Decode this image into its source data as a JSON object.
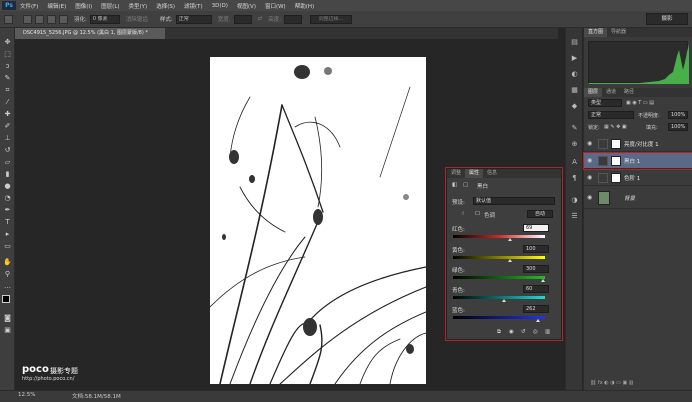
{
  "app": {
    "logo": "Ps"
  },
  "menu": [
    "文件(F)",
    "编辑(E)",
    "图像(I)",
    "图层(L)",
    "类型(Y)",
    "选择(S)",
    "滤镜(T)",
    "3D(D)",
    "视图(V)",
    "窗口(W)",
    "帮助(H)"
  ],
  "options_bar": {
    "feather_label": "羽化:",
    "feather_value": "0 像素",
    "antialias_label": "消除锯齿",
    "style_label": "样式:",
    "style_value": "正常",
    "width_label": "宽度:",
    "height_label": "高度:",
    "refine_button": "调整边缘...",
    "workspace": "摄影"
  },
  "document": {
    "tab_title": "DSC4915_5256.JPG @ 12.5% (黑白 1, 图层蒙版/8) *"
  },
  "properties": {
    "tabs": [
      "调整",
      "属性",
      "信息"
    ],
    "title": "黑白",
    "preset_label": "预设:",
    "preset_value": "默认值",
    "tint_label": "色调",
    "auto_button": "自动",
    "sliders": [
      {
        "label": "红色:",
        "value": "69",
        "percent": 0.62,
        "from": "#c82a2a",
        "to": "#ffffff",
        "start": "#000000"
      },
      {
        "label": "黄色:",
        "value": "100",
        "percent": 0.62,
        "from": "#000000",
        "to": "#ffff00"
      },
      {
        "label": "绿色:",
        "value": "300",
        "percent": 0.98,
        "from": "#000000",
        "to": "#21c021"
      },
      {
        "label": "青色:",
        "value": "60",
        "percent": 0.55,
        "from": "#000000",
        "to": "#22d8d8"
      },
      {
        "label": "蓝色:",
        "value": "262",
        "percent": 0.92,
        "from": "#000000",
        "to": "#2233ee"
      }
    ]
  },
  "panels": {
    "histogram_tabs": [
      "直方图",
      "导航器"
    ],
    "layers_tabs": [
      "图层",
      "通道",
      "路径"
    ],
    "kind_value": "类型",
    "blend_value": "正常",
    "opacity_label": "不透明度:",
    "opacity_value": "100%",
    "lock_label": "锁定:",
    "fill_label": "填充:",
    "fill_value": "100%",
    "layers": [
      {
        "name": "亮度/对比度 1",
        "selected": false
      },
      {
        "name": "黑白 1",
        "selected": true
      },
      {
        "name": "色阶 1",
        "selected": false
      },
      {
        "name": "背景",
        "selected": false
      }
    ]
  },
  "status": {
    "zoom": "12.5%",
    "doc_size": "文档:58.1M/58.1M"
  },
  "watermark": {
    "brand": "poco",
    "title": "摄影专题",
    "url": "http://photo.poco.cn/"
  }
}
